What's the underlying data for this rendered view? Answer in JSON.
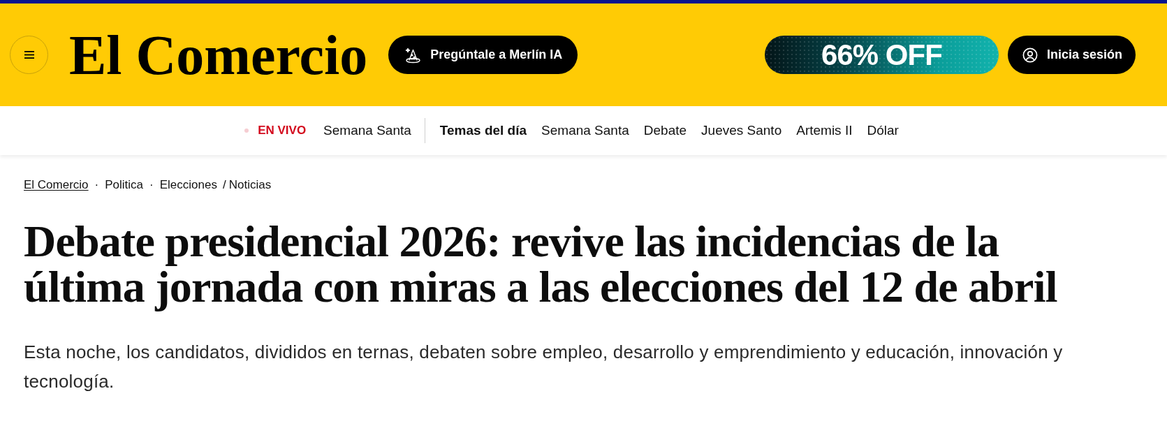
{
  "header": {
    "logo": "El Comercio",
    "ai_button": "Pregúntale a Merlín IA",
    "promo": "66% OFF",
    "login_button": "Inicia sesión"
  },
  "topics_bar": {
    "live_label": "EN VIVO",
    "live_link": "Semana Santa",
    "topics_label": "Temas del día",
    "topics": [
      "Semana Santa",
      "Debate",
      "Jueves Santo",
      "Artemis II",
      "Dólar"
    ]
  },
  "breadcrumb": [
    {
      "label": "El Comercio",
      "underlined": true
    },
    {
      "separator": "·",
      "label": "Politica",
      "underlined": false
    },
    {
      "separator": "·",
      "label": "Elecciones",
      "underlined": false
    },
    {
      "separator": "/",
      "label": "Noticias",
      "underlined": false
    }
  ],
  "article": {
    "title": "Debate presidencial 2026: revive las incidencias de la última jornada con miras a las elecciones del 12 de abril",
    "summary": "Esta noche, los candidatos, divididos en ternas, debaten sobre empleo, desarrollo y emprendimiento y educación, innovación y tecnología."
  }
}
